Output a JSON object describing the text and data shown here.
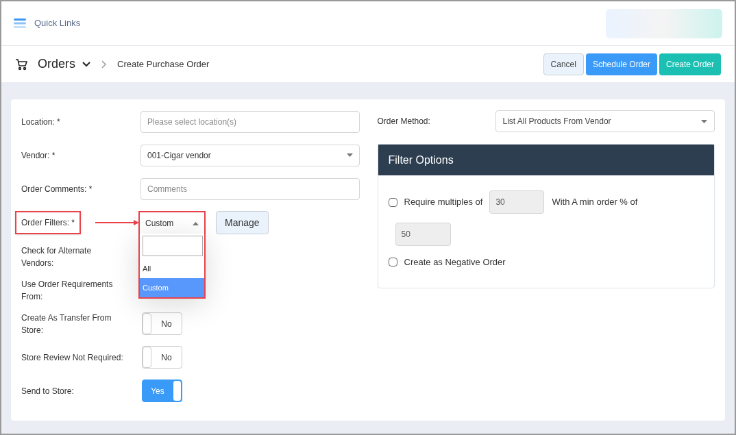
{
  "top_bar": {
    "quick_links": "Quick Links"
  },
  "breadcrumb": {
    "section": "Orders",
    "page": "Create Purchase Order"
  },
  "actions": [
    {
      "label": "Cancel",
      "kind": "secondary"
    },
    {
      "label": "Schedule Order",
      "kind": "primary"
    },
    {
      "label": "Create Order",
      "kind": "success"
    }
  ],
  "form": [
    {
      "label": "Location: *",
      "kind": "text",
      "placeholder": "Please select location(s)"
    },
    {
      "label": "Vendor: *",
      "kind": "select",
      "value": "001-Cigar vendor"
    },
    {
      "label": "Order Comments: *",
      "kind": "text",
      "placeholder": "Comments"
    },
    {
      "label": "Order Filters: *",
      "kind": "dropdown",
      "value": "Custom",
      "highlighted": true,
      "expanded": true,
      "button": "Manage",
      "options": [
        {
          "label": "All",
          "selected": false
        },
        {
          "label": "Custom",
          "selected": true
        }
      ]
    },
    {
      "label": "Check for Alternate Vendors:",
      "kind": "label"
    },
    {
      "label": "Use Order Requirements From:",
      "kind": "label"
    },
    {
      "label": "Create As Transfer From Store:",
      "kind": "toggle",
      "on": false,
      "text": "No"
    },
    {
      "label": "Store Review Not Required:",
      "kind": "toggle",
      "on": false,
      "text": "No"
    },
    {
      "label": "Send to Store:",
      "kind": "toggle",
      "on": true,
      "text": "Yes"
    }
  ],
  "order_method": {
    "label": "Order Method:",
    "value": "List All Products From Vendor"
  },
  "filter_options": {
    "title": "Filter Options",
    "multiples": {
      "checked": false,
      "label": "Require multiples of",
      "value": "30",
      "min_label": "With A min order % of",
      "min_value": "50"
    },
    "negative": {
      "checked": false,
      "label": "Create as Negative Order"
    }
  }
}
